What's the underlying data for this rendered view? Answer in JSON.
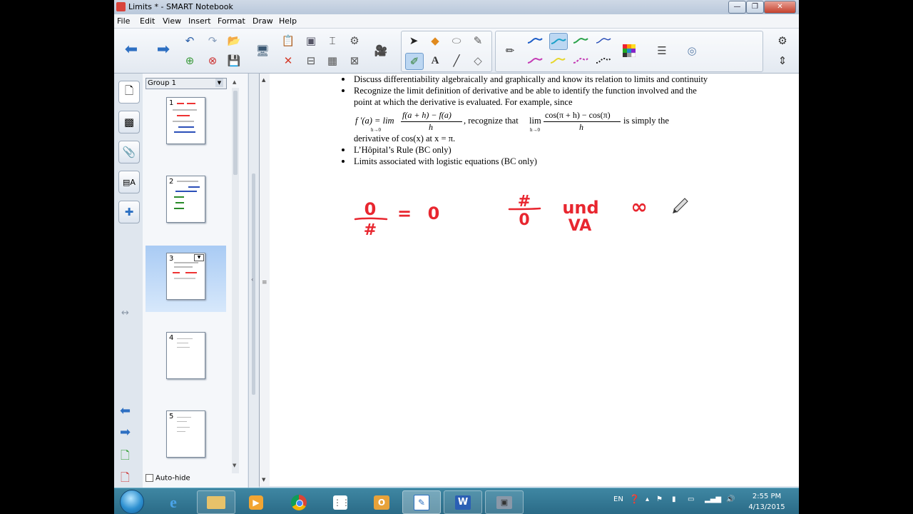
{
  "window": {
    "title": "Limits * - SMART Notebook",
    "minimize_glyph": "—",
    "maximize_glyph": "❐",
    "close_glyph": "✕"
  },
  "menu": [
    "File",
    "Edit",
    "View",
    "Insert",
    "Format",
    "Draw",
    "Help"
  ],
  "toolbar": {
    "icons": [
      "back-icon",
      "forward-icon",
      "undo-icon",
      "redo-icon",
      "add-page-icon",
      "delete-page-icon",
      "open-file-icon",
      "save-icon",
      "screen-shade-icon",
      "paste-icon",
      "delete-icon",
      "clone-icon",
      "table-icon",
      "capture-icon",
      "properties-icon",
      "select-icon",
      "shapes-icon",
      "eraser-icon",
      "magic-pen-icon",
      "pens-icon",
      "text-icon",
      "line-icon",
      "fill-icon",
      "pen-icon",
      "pen-style-1",
      "pen-style-2",
      "pen-style-3",
      "pen-style-4",
      "pen-style-5",
      "pen-style-6",
      "pen-style-7",
      "pen-style-8",
      "color-palette-icon",
      "line-style-icon",
      "transparency-icon",
      "settings-icon",
      "move-toolbar-icon"
    ],
    "colors": {
      "pen_blue": "#1b5cc7",
      "pen_cyan": "#1aa0c8",
      "pen_green": "#2aa34a",
      "pen_magenta": "#c43bb4",
      "pen_yellow": "#e6d62c",
      "pen_black": "#222222"
    }
  },
  "sorter": {
    "group_label": "Group 1",
    "autohide_label": "Auto-hide",
    "pages": [
      {
        "number": "1"
      },
      {
        "number": "2"
      },
      {
        "number": "3",
        "current": true
      },
      {
        "number": "4"
      },
      {
        "number": "5"
      }
    ]
  },
  "content": {
    "bullets": [
      "Discuss differentiability algebraically and graphically and know its relation to limits and continuity",
      "Recognize the limit definition of derivative and be able to identify the function involved and the point at which the derivative is evaluated. For example, since",
      "L’Hôpital’s Rule (BC only)",
      "Limits associated with logistic equations (BC only)"
    ],
    "formula": {
      "lhs": "f ′(a) = lim",
      "lim_sub": "h→0",
      "num": "f(a + h) − f(a)",
      "den": "h",
      "recognize": ", recognize that",
      "lim2": "lim",
      "lim2_sub": "h→0",
      "num2": "cos(π + h) − cos(π)",
      "den2": "h",
      "tail": "is simply the"
    },
    "derivative_line": "derivative of cos(x) at x = π.",
    "ink": {
      "color": "#e8262f",
      "left_numerator": "0",
      "left_denominator": "#",
      "equals": "=",
      "left_result": "0",
      "right_numerator": "#",
      "right_denominator": "0",
      "und": "und",
      "va": "VA",
      "infinity": "∞"
    }
  },
  "taskbar": {
    "apps": [
      "ie-icon",
      "explorer-icon",
      "media-player-icon",
      "chrome-icon",
      "store-icon",
      "outlook-icon",
      "smart-notebook-icon",
      "word-icon",
      "video-icon"
    ],
    "language": "EN",
    "time": "2:55 PM",
    "date": "4/13/2015"
  }
}
